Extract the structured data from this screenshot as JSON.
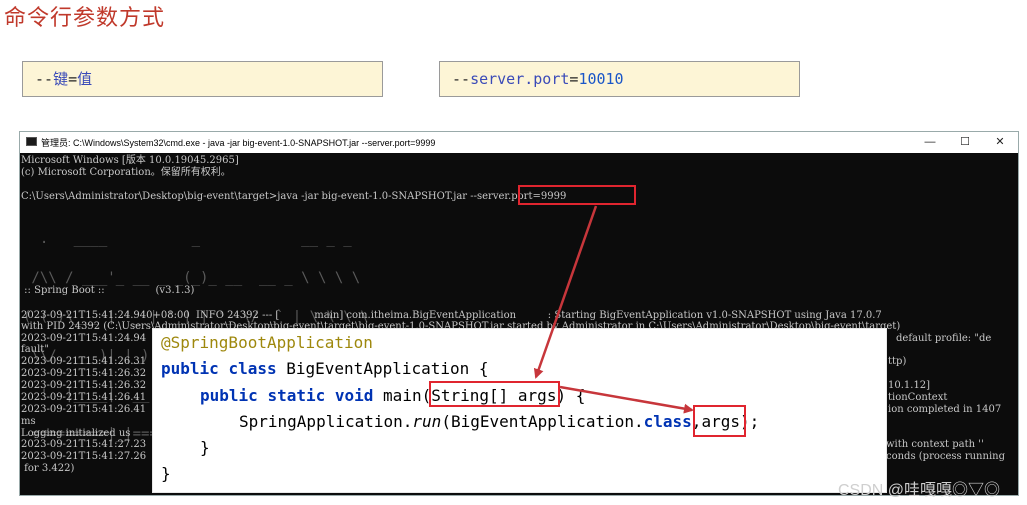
{
  "heading": "命令行参数方式",
  "boxes": {
    "box1": {
      "prefix": "--",
      "key": "键",
      "eq": "=",
      "value": "值"
    },
    "box2": {
      "prefix": "--",
      "key": "server.port",
      "eq": "=",
      "value": "10010"
    }
  },
  "window": {
    "title": "管理员: C:\\Windows\\System32\\cmd.exe - java  -jar big-event-1.0-SNAPSHOT.jar --server.port=9999",
    "minimize": "—",
    "maximize": "☐",
    "close": "✕"
  },
  "terminal": {
    "lines": [
      "Microsoft Windows [版本 10.0.19045.2965]",
      "(c) Microsoft Corporation。保留所有权利。",
      "",
      "C:\\Users\\Administrator\\Desktop\\big-event\\target>java -jar big-event-1.0-SNAPSHOT.jar --server.port=9999"
    ],
    "spring_logo": [
      "  .   ____          _            __ _ _",
      " /\\\\ / ___'_ __ _ _(_)_ __  __ _ \\ \\ \\ \\",
      "( ( )\\___ | '_ | '_| | '_ \\/ _` | \\ \\ \\ \\",
      " \\\\/  ___)| |_)| | | | | || (_| |  ) ) ) )",
      "  '  |____| .__|_| |_|_| |_\\__, | / / / /",
      " =========|_|==============|___/=/_/_/_/"
    ],
    "spring_boot_line": " :: Spring Boot ::                (v3.1.3)",
    "log_lines": [
      "2023-09-21T15:41:24.940+08:00  INFO 24392 --- [           main] com.itheima.BigEventApplication          : Starting BigEventApplication v1.0-SNAPSHOT using Java 17.0.7",
      "with PID 24392 (C:\\Users\\Administrator\\Desktop\\big-event\\target\\big-event-1.0-SNAPSHOT.jar started by Administrator in C:\\Users\\Administrator\\Desktop\\big-event\\target)",
      "2023-09-21T15:41:24.94",
      "fault\"",
      "2023-09-21T15:41:26.31",
      "2023-09-21T15:41:26.32",
      "2023-09-21T15:41:26.32",
      "2023-09-21T15:41:26.41",
      "2023-09-21T15:41:26.41",
      "ms",
      "Logging initialized us",
      "2023-09-21T15:41:27.23",
      "2023-09-21T15:41:27.26",
      " for 3.422)"
    ],
    "right_fragments": [
      "default profile: \"de",
      "ttp)",
      "10.1.12]",
      "tionContext",
      "ion completed in 1407",
      "with context path ''",
      "conds (process running"
    ]
  },
  "code": {
    "annotation": "@SpringBootApplication",
    "kw_public": "public",
    "kw_class": "class",
    "class_name": "BigEventApplication",
    "open_brace": "{",
    "kw_static": "static",
    "kw_void": "void",
    "method": "main",
    "param": "String[] args",
    "open_method": "{",
    "call_class": "SpringApplication",
    "call_method": "run",
    "call_arg1": "BigEventApplication",
    "call_class_kw": "class",
    "call_arg2": "args",
    "close_call": ");",
    "close_method": "}",
    "close_class": "}"
  },
  "watermark": "CSDN @哇嘎嘎◎▽◎",
  "colors": {
    "heading": "#c0392b",
    "highlight_border": "#e0252f",
    "code_box_bg": "#fdf5d6",
    "terminal_bg": "#0c0c0c",
    "keyword": "#0033b3",
    "annotation": "#9e880d"
  },
  "icons": [
    "cmd-icon",
    "minimize-icon",
    "maximize-icon",
    "close-icon",
    "arrow-icon"
  ]
}
